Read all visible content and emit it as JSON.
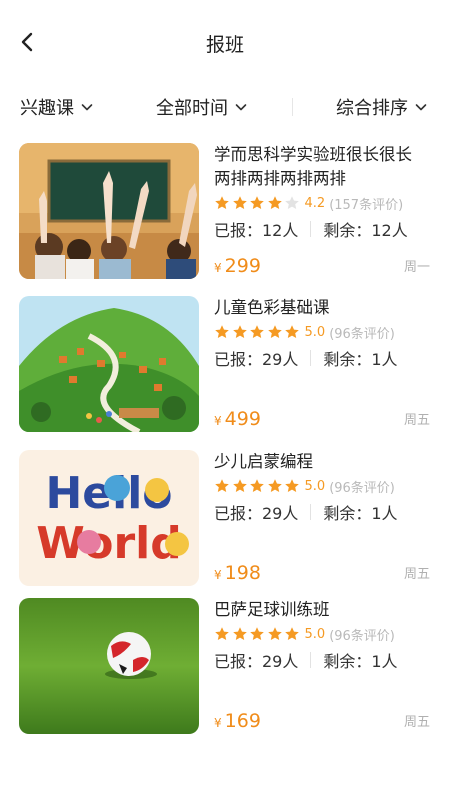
{
  "header": {
    "title": "报班",
    "back_icon": "chevron-left-icon"
  },
  "filters": [
    {
      "label": "兴趣课"
    },
    {
      "label": "全部时间"
    },
    {
      "label": "综合排序"
    }
  ],
  "colors": {
    "accent": "#f08c1a",
    "star": "#f59a23",
    "star_empty": "#e3e3e3",
    "muted": "#b0b0b0"
  },
  "courses": [
    {
      "name": "学而思科学实验班很长很长两排两排两排两排",
      "stars": 4,
      "score": "4.2",
      "reviews": "(157条评价)",
      "enrolled": "已报：12人",
      "remaining": "剩余：12人",
      "currency": "¥",
      "price": "299",
      "day": "周一",
      "image": "classroom-hands-raised"
    },
    {
      "name": "儿童色彩基础课",
      "stars": 5,
      "score": "5.0",
      "reviews": "(96条评价)",
      "enrolled": "已报：29人",
      "remaining": "剩余：1人",
      "currency": "¥",
      "price": "499",
      "day": "周五",
      "image": "painted-green-hill-village"
    },
    {
      "name": "少儿启蒙编程",
      "stars": 5,
      "score": "5.0",
      "reviews": "(96条评价)",
      "enrolled": "已报：29人",
      "remaining": "剩余：1人",
      "currency": "¥",
      "price": "198",
      "day": "周五",
      "image": "hello-world-colorful-letters",
      "image_text": [
        "Hello",
        "World"
      ]
    },
    {
      "name": "巴萨足球训练班",
      "stars": 5,
      "score": "5.0",
      "reviews": "(96条评价)",
      "enrolled": "已报：29人",
      "remaining": "剩余：1人",
      "currency": "¥",
      "price": "169",
      "day": "周五",
      "image": "soccer-ball-on-grass"
    }
  ]
}
